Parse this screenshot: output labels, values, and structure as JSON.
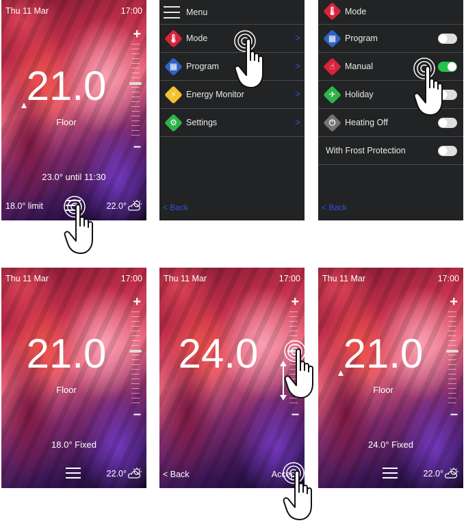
{
  "screens": {
    "home": {
      "date": "Thu 11 Mar",
      "time": "17:00",
      "plus": "+",
      "minus": "–",
      "temperature": "21.0",
      "sensor": "Floor",
      "status": "23.0° until 11:30",
      "limit": "18.0° limit",
      "outdoor": "22.0°"
    },
    "menu": {
      "title": "Menu",
      "items": [
        {
          "label": "Mode",
          "icon": "thermometer-icon",
          "color": "#d8233c"
        },
        {
          "label": "Program",
          "icon": "calendar-icon",
          "color": "#2f64c4"
        },
        {
          "label": "Energy Monitor",
          "icon": "lightning-icon",
          "color": "#f2c12e"
        },
        {
          "label": "Settings",
          "icon": "gear-icon",
          "color": "#2eb34a"
        }
      ],
      "chevron": ">",
      "back": "< Back"
    },
    "mode": {
      "title": "Mode",
      "items": [
        {
          "label": "Program",
          "icon": "calendar-icon",
          "on": false
        },
        {
          "label": "Manual",
          "icon": "hand-icon",
          "on": true
        },
        {
          "label": "Holiday",
          "icon": "plane-icon",
          "on": false
        },
        {
          "label": "Heating Off",
          "icon": "power-icon",
          "on": false
        },
        {
          "label": "With Frost Protection",
          "on": false
        }
      ],
      "back": "< Back"
    },
    "manual": {
      "date": "Thu 11 Mar",
      "time": "17:00",
      "plus": "+",
      "minus": "–",
      "temperature": "21.0",
      "sensor": "Floor",
      "status": "18.0° Fixed",
      "outdoor": "22.0°"
    },
    "adjust": {
      "date": "Thu 11 Mar",
      "time": "17:00",
      "plus": "+",
      "minus": "–",
      "temperature": "24.0",
      "back": "< Back",
      "accept": "Accept"
    },
    "result": {
      "date": "Thu 11 Mar",
      "time": "17:00",
      "plus": "+",
      "minus": "–",
      "temperature": "21.0",
      "sensor": "Floor",
      "status": "24.0° Fixed",
      "outdoor": "22.0°"
    }
  },
  "colors": {
    "accent_blue": "#2f53d8",
    "toggle_on": "#25c14c",
    "panel_dark": "#222324"
  }
}
